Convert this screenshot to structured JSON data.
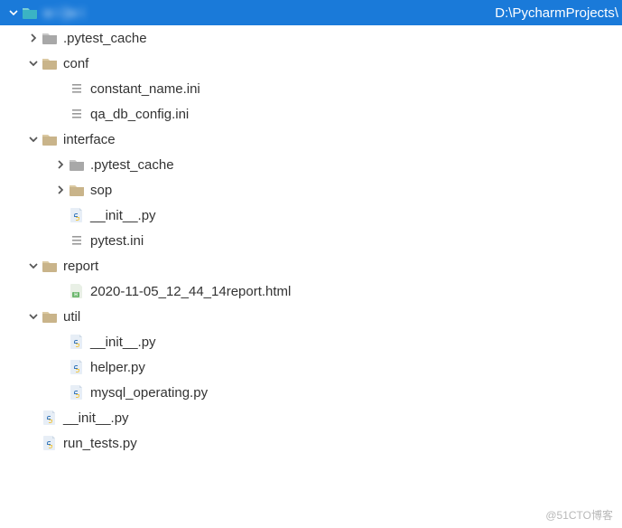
{
  "header": {
    "project_name": "w        i [w                i",
    "path_suffix": "D:\\PycharmProjects\\"
  },
  "icons": {
    "folder_teal": "#3bb3c4",
    "folder_tan": "#c9b48a",
    "folder_gray": "#a8a8a8",
    "file_gray": "#9a9a9a",
    "py_yellow": "#f0c84e",
    "py_blue": "#3b7abb",
    "html_green": "#6cb66d"
  },
  "tree": [
    {
      "depth": 1,
      "arrow": "right",
      "icon": "folder-gray",
      "label": ".pytest_cache"
    },
    {
      "depth": 1,
      "arrow": "down",
      "icon": "folder-tan",
      "label": "conf"
    },
    {
      "depth": 2,
      "arrow": null,
      "icon": "ini",
      "label": "constant_name.ini"
    },
    {
      "depth": 2,
      "arrow": null,
      "icon": "ini",
      "label": "qa_db_config.ini"
    },
    {
      "depth": 1,
      "arrow": "down",
      "icon": "folder-tan",
      "label": "interface"
    },
    {
      "depth": 2,
      "arrow": "right",
      "icon": "folder-gray",
      "label": ".pytest_cache"
    },
    {
      "depth": 2,
      "arrow": "right",
      "icon": "folder-tan",
      "label": "sop"
    },
    {
      "depth": 2,
      "arrow": null,
      "icon": "py",
      "label": "__init__.py"
    },
    {
      "depth": 2,
      "arrow": null,
      "icon": "ini",
      "label": "pytest.ini"
    },
    {
      "depth": 1,
      "arrow": "down",
      "icon": "folder-tan",
      "label": "report"
    },
    {
      "depth": 2,
      "arrow": null,
      "icon": "html",
      "label": "2020-11-05_12_44_14report.html"
    },
    {
      "depth": 1,
      "arrow": "down",
      "icon": "folder-tan",
      "label": "util"
    },
    {
      "depth": 2,
      "arrow": null,
      "icon": "py",
      "label": "__init__.py"
    },
    {
      "depth": 2,
      "arrow": null,
      "icon": "py",
      "label": "helper.py"
    },
    {
      "depth": 2,
      "arrow": null,
      "icon": "py",
      "label": "mysql_operating.py"
    },
    {
      "depth": 1,
      "arrow": null,
      "icon": "py",
      "label": "__init__.py"
    },
    {
      "depth": 1,
      "arrow": null,
      "icon": "py",
      "label": "run_tests.py"
    }
  ],
  "watermark": "@51CTO博客"
}
